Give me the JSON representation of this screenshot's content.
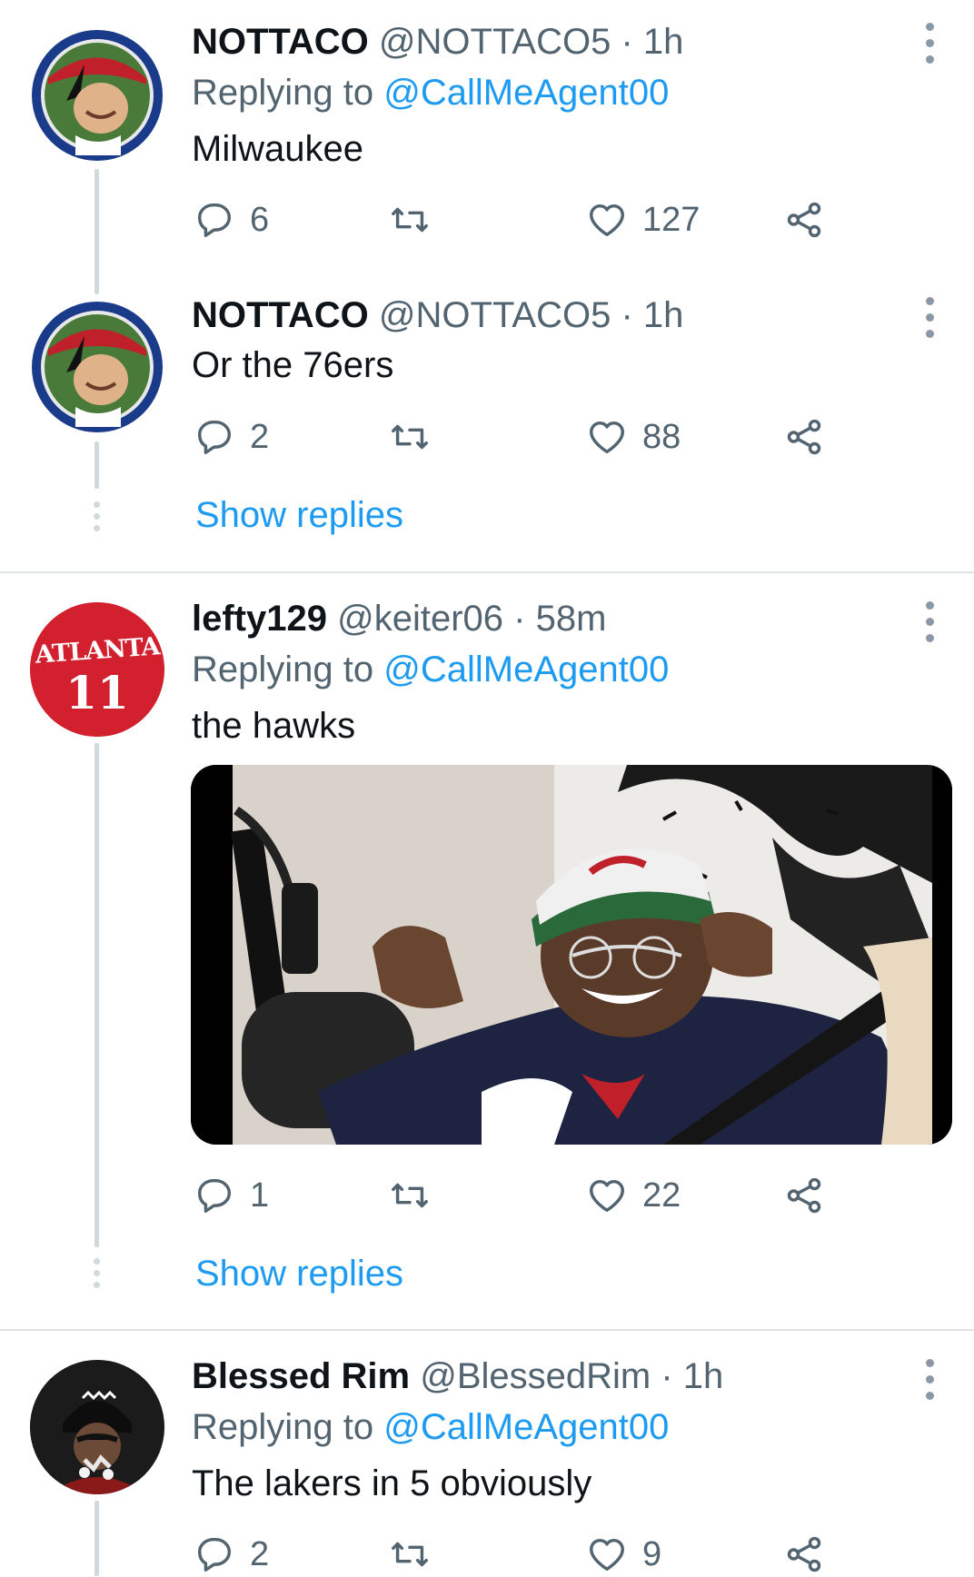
{
  "tweets": [
    {
      "name": "NOTTACO",
      "handle": "@NOTTACO5",
      "time": "· 1h",
      "replying_label": "Replying to",
      "replying_handle": "@CallMeAgent00",
      "text": "Milwaukee",
      "replies": "6",
      "retweets": "",
      "likes": "127"
    },
    {
      "name": "NOTTACO",
      "handle": "@NOTTACO5",
      "time": "· 1h",
      "text": "Or the 76ers",
      "replies": "2",
      "retweets": "",
      "likes": "88",
      "show_replies": "Show replies"
    },
    {
      "name": "lefty129",
      "handle": "@keiter06",
      "time": "· 58m",
      "replying_label": "Replying to",
      "replying_handle": "@CallMeAgent00",
      "text": "the hawks",
      "replies": "1",
      "retweets": "",
      "likes": "22",
      "show_replies": "Show replies",
      "avatar_text_top": "ATLANTA",
      "avatar_text_bottom": "11"
    },
    {
      "name": "Blessed Rim",
      "handle": "@BlessedRim",
      "time": "· 1h",
      "replying_label": "Replying to",
      "replying_handle": "@CallMeAgent00",
      "text": "The lakers in 5 obviously",
      "replies": "2",
      "retweets": "",
      "likes": "9"
    }
  ],
  "colors": {
    "link": "#1d9bf0",
    "muted": "#536471",
    "thread": "#cfd9de",
    "hawks_red": "#d3202f"
  },
  "icons": [
    "reply-icon",
    "retweet-icon",
    "like-icon",
    "share-icon",
    "more-icon"
  ]
}
